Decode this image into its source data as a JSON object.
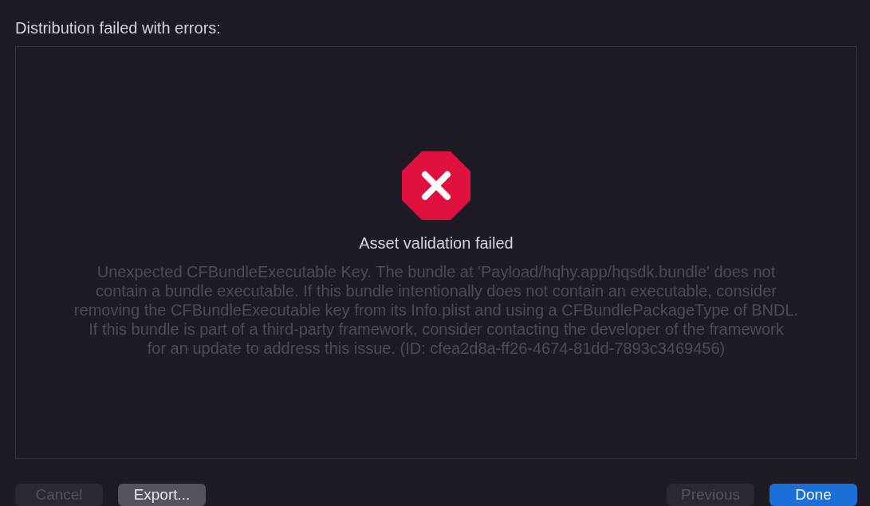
{
  "heading": "Distribution failed with errors:",
  "error": {
    "title": "Asset validation failed",
    "message_lines": [
      "Unexpected CFBundleExecutable Key. The bundle at 'Payload/hqhy.app/hqsdk.bundle' does not",
      "contain a bundle executable. If this bundle intentionally does not contain an executable, consider",
      "removing the CFBundleExecutable key from its Info.plist and using a CFBundlePackageType of BNDL.",
      "If this bundle is part of a third-party framework, consider contacting the developer of the framework",
      "for an update to address this issue. (ID: cfea2d8a-ff26-4674-81dd-7893c3469456)"
    ]
  },
  "buttons_left": [
    {
      "label": "Cancel",
      "disabled": true,
      "default": false
    },
    {
      "label": "Export...",
      "disabled": false,
      "default": false
    }
  ],
  "buttons_right": [
    {
      "label": "Previous",
      "disabled": true,
      "default": false
    },
    {
      "label": "Done",
      "disabled": false,
      "default": true
    }
  ]
}
